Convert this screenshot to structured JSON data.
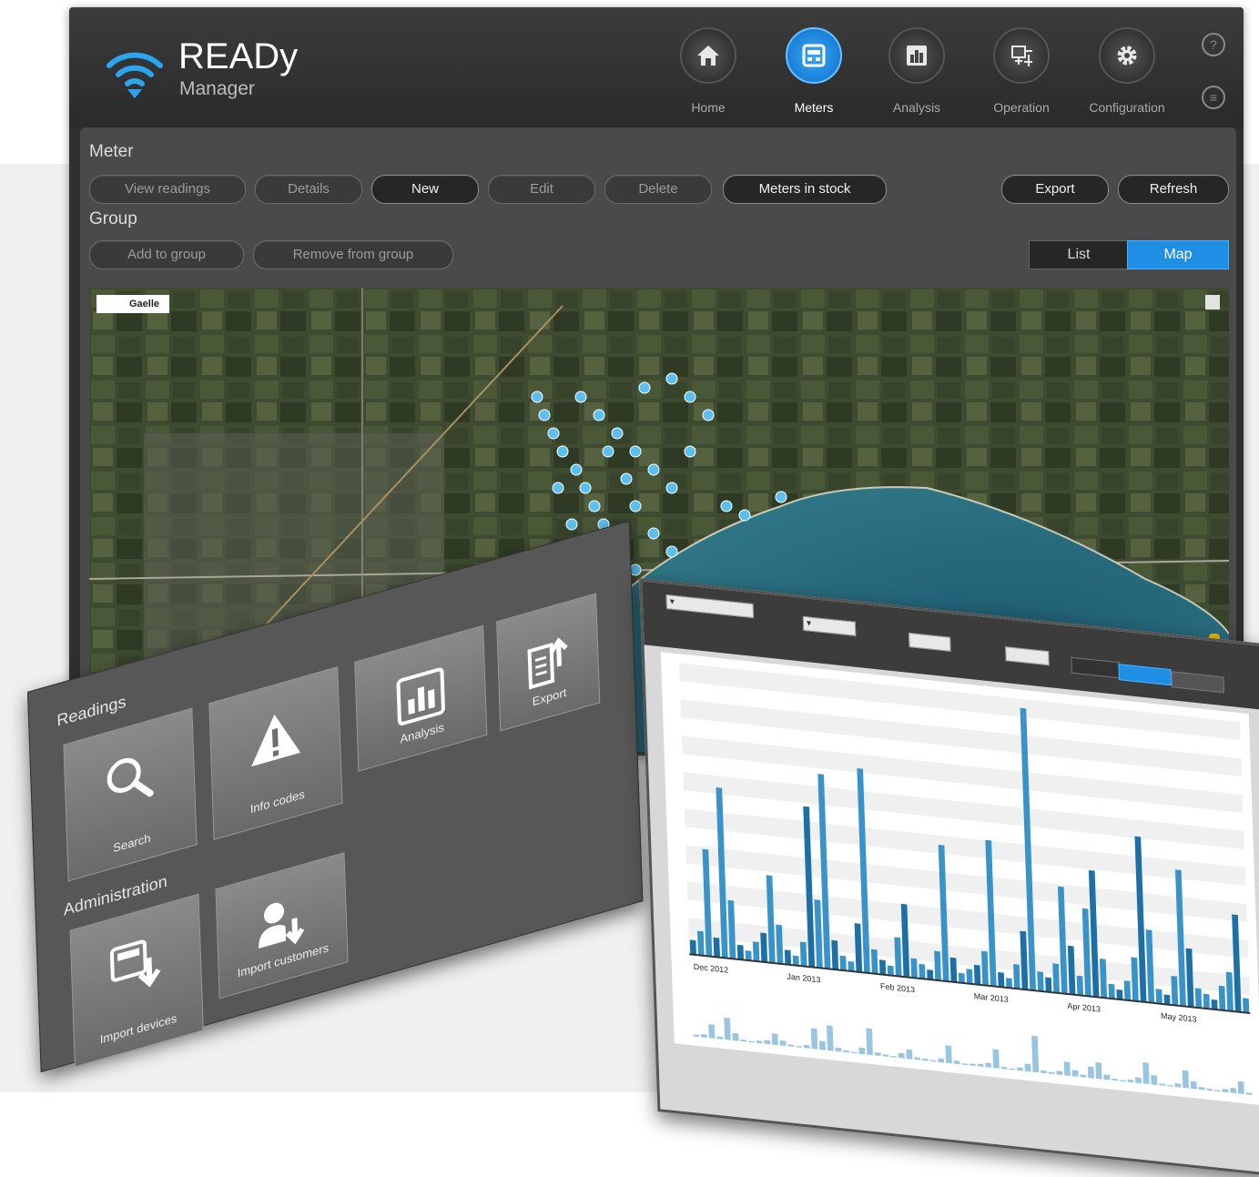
{
  "app": {
    "title": "READy",
    "subtitle": "Manager"
  },
  "nav": [
    {
      "label": "Home",
      "icon": "home-icon",
      "active": false
    },
    {
      "label": "Meters",
      "icon": "meter-icon",
      "active": true
    },
    {
      "label": "Analysis",
      "icon": "analysis-icon",
      "active": false
    },
    {
      "label": "Operation",
      "icon": "operation-icon",
      "active": false
    },
    {
      "label": "Configuration",
      "icon": "gear-icon",
      "active": false
    }
  ],
  "side_icons": {
    "help": "?",
    "menu": "≡"
  },
  "meter_section": {
    "label": "Meter",
    "buttons": [
      {
        "label": "View readings",
        "enabled": false
      },
      {
        "label": "Details",
        "enabled": false
      },
      {
        "label": "New",
        "enabled": true
      },
      {
        "label": "Edit",
        "enabled": false
      },
      {
        "label": "Delete",
        "enabled": false
      },
      {
        "label": "Meters in stock",
        "enabled": true
      }
    ],
    "export_label": "Export",
    "refresh_label": "Refresh"
  },
  "group_section": {
    "label": "Group",
    "buttons": [
      {
        "label": "Add to group",
        "enabled": false
      },
      {
        "label": "Remove from group",
        "enabled": false
      }
    ]
  },
  "view_toggle": {
    "list": "List",
    "map": "Map",
    "selected": "Map"
  },
  "map": {
    "attribution": "Gaelle"
  },
  "tiles_panel": {
    "readings_heading": "Readings",
    "readings": [
      {
        "label": "Search",
        "icon": "search-icon"
      },
      {
        "label": "Info codes",
        "icon": "warning-icon"
      },
      {
        "label": "Analysis",
        "icon": "bar-chart-icon"
      },
      {
        "label": "Export",
        "icon": "export-icon"
      }
    ],
    "administration_heading": "Administration",
    "administration": [
      {
        "label": "Import devices",
        "icon": "import-device-icon"
      },
      {
        "label": "Import customers",
        "icon": "import-customer-icon"
      }
    ]
  },
  "chart_data": {
    "type": "bar",
    "title": "",
    "xlabel": "",
    "ylabel": "",
    "series": [
      {
        "values": [
          3,
          5,
          22,
          4,
          35,
          12,
          3,
          2,
          4,
          6,
          18,
          8,
          3,
          2,
          5,
          33,
          14,
          40,
          6,
          3,
          2,
          10,
          42,
          5,
          3,
          2,
          8,
          15,
          4,
          3,
          2,
          6,
          28,
          5,
          2,
          3,
          4,
          7,
          30,
          3,
          2,
          5,
          12,
          58,
          4,
          3,
          6,
          22,
          10,
          4,
          18,
          26,
          8,
          3,
          2,
          4,
          9,
          34,
          15,
          3,
          2,
          6,
          28,
          12,
          4,
          3,
          2,
          5,
          8,
          20,
          3
        ]
      }
    ],
    "x_ticks": [
      "Dec 2012",
      "Jan 2013",
      "Feb 2013",
      "Mar 2013",
      "Apr 2013",
      "May 2013"
    ],
    "grid": true
  }
}
